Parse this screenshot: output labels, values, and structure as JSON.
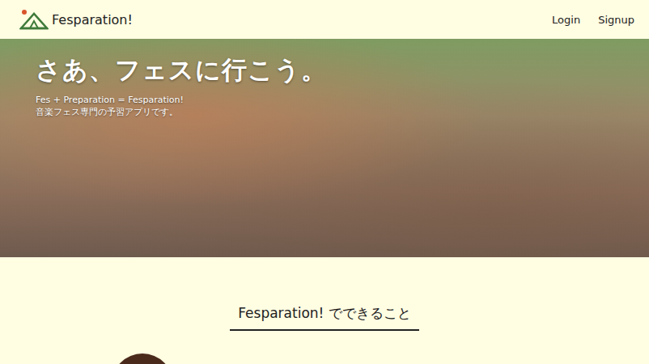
{
  "header": {
    "logo_text": "Fesparation!",
    "nav": [
      {
        "label": "Login"
      },
      {
        "label": "Signup"
      }
    ]
  },
  "hero": {
    "title": "さあ、フェスに行こう。",
    "subtitle_lines": [
      "Fes + Preparation = Fesparation!",
      "音楽フェス専門の予習アプリです。"
    ]
  },
  "features": {
    "title": "Fesparation! でできること"
  }
}
